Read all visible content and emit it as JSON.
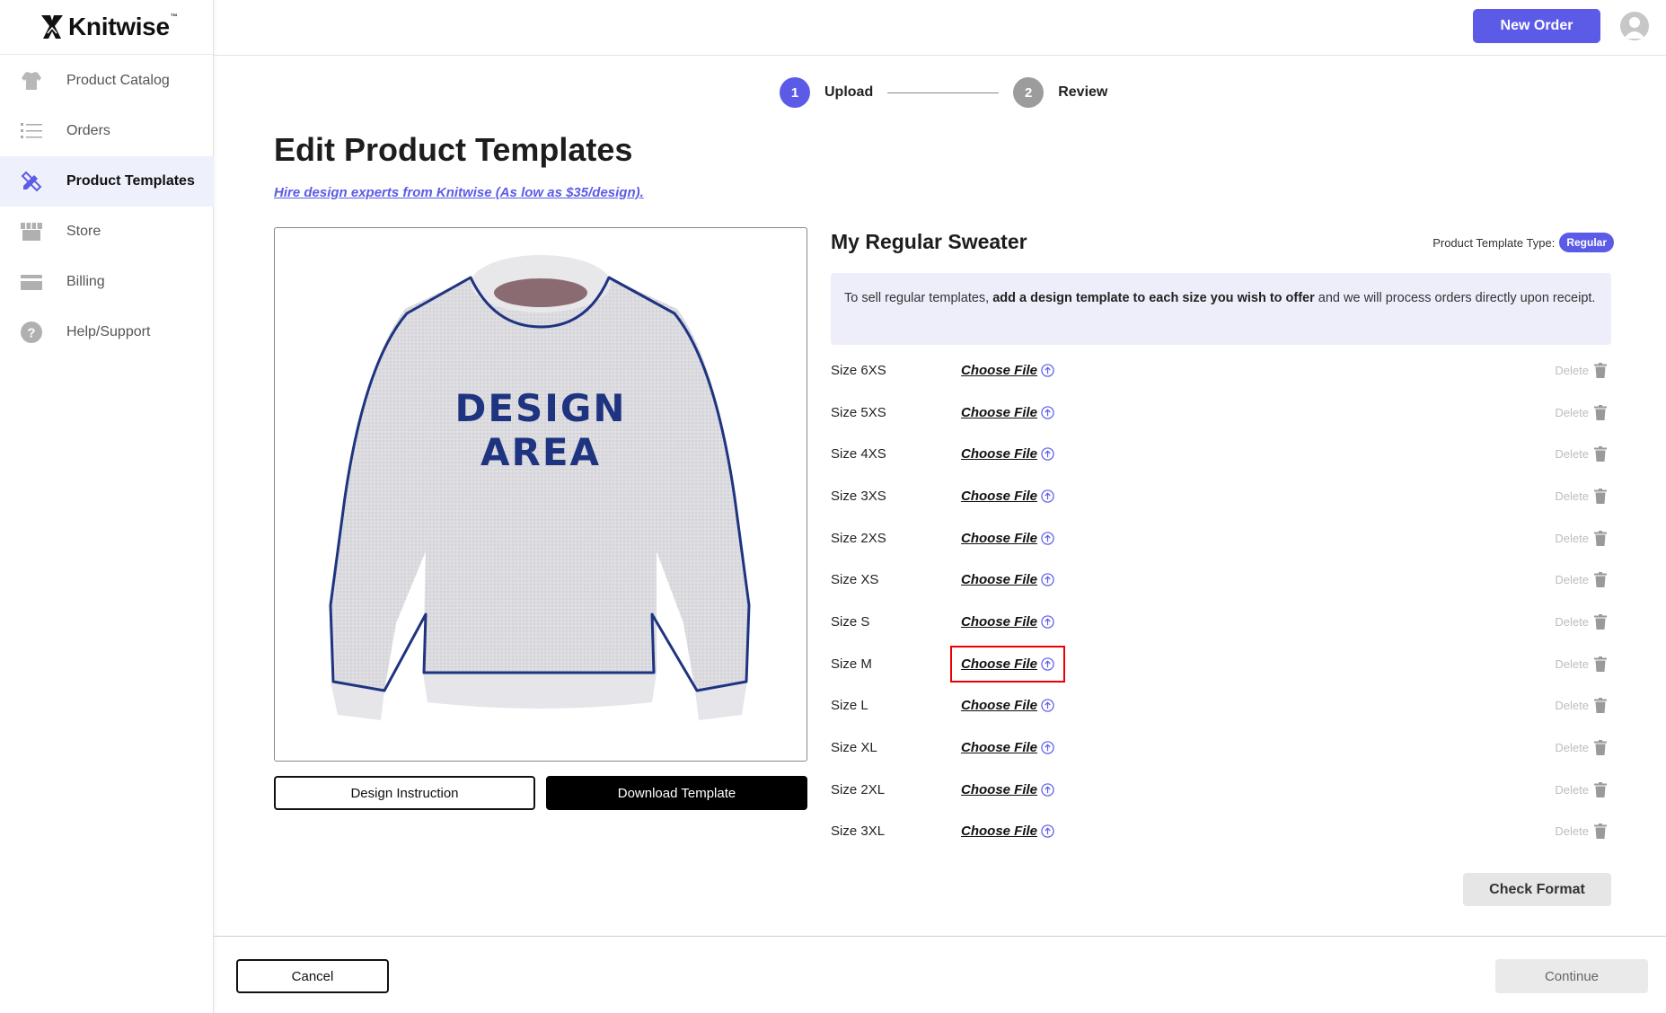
{
  "brand": {
    "name": "Knitwise",
    "tm": "™"
  },
  "sidebar": {
    "items": [
      {
        "label": "Product Catalog",
        "icon": "sweater-icon"
      },
      {
        "label": "Orders",
        "icon": "list-icon"
      },
      {
        "label": "Product Templates",
        "icon": "pencil-ruler-icon",
        "active": true
      },
      {
        "label": "Store",
        "icon": "store-icon"
      },
      {
        "label": "Billing",
        "icon": "card-icon"
      },
      {
        "label": "Help/Support",
        "icon": "help-icon"
      }
    ]
  },
  "header": {
    "new_order_label": "New Order"
  },
  "stepper": {
    "steps": [
      {
        "number": "1",
        "label": "Upload",
        "state": "active"
      },
      {
        "number": "2",
        "label": "Review",
        "state": "inactive"
      }
    ]
  },
  "page": {
    "title": "Edit Product Templates",
    "hire_link": "Hire design experts from Knitwise (As low as $35/design)."
  },
  "preview": {
    "design_area_line1": "DESIGN",
    "design_area_line2": "AREA",
    "instruction_button": "Design Instruction",
    "download_button": "Download Template"
  },
  "product": {
    "name": "My Regular Sweater",
    "type_label": "Product Template Type:",
    "type_value": "Regular",
    "info_prefix": "To sell regular templates, ",
    "info_bold": "add a design template to each size you wish to offer",
    "info_suffix": " and we will process orders directly upon receipt."
  },
  "sizes": [
    {
      "label": "Size 6XS",
      "action": "Choose File",
      "delete": "Delete"
    },
    {
      "label": "Size 5XS",
      "action": "Choose File",
      "delete": "Delete"
    },
    {
      "label": "Size 4XS",
      "action": "Choose File",
      "delete": "Delete"
    },
    {
      "label": "Size 3XS",
      "action": "Choose File",
      "delete": "Delete"
    },
    {
      "label": "Size 2XS",
      "action": "Choose File",
      "delete": "Delete"
    },
    {
      "label": "Size XS",
      "action": "Choose File",
      "delete": "Delete"
    },
    {
      "label": "Size S",
      "action": "Choose File",
      "delete": "Delete"
    },
    {
      "label": "Size M",
      "action": "Choose File",
      "delete": "Delete",
      "highlighted": true
    },
    {
      "label": "Size L",
      "action": "Choose File",
      "delete": "Delete"
    },
    {
      "label": "Size XL",
      "action": "Choose File",
      "delete": "Delete"
    },
    {
      "label": "Size 2XL",
      "action": "Choose File",
      "delete": "Delete"
    },
    {
      "label": "Size 3XL",
      "action": "Choose File",
      "delete": "Delete"
    }
  ],
  "actions": {
    "check_format": "Check Format",
    "cancel": "Cancel",
    "continue": "Continue"
  },
  "colors": {
    "accent": "#5b5be8",
    "info_bg": "#eeeefb",
    "active_nav_bg": "#eef0fb",
    "outline_navy": "#1f3480",
    "highlight": "#ee0000"
  }
}
